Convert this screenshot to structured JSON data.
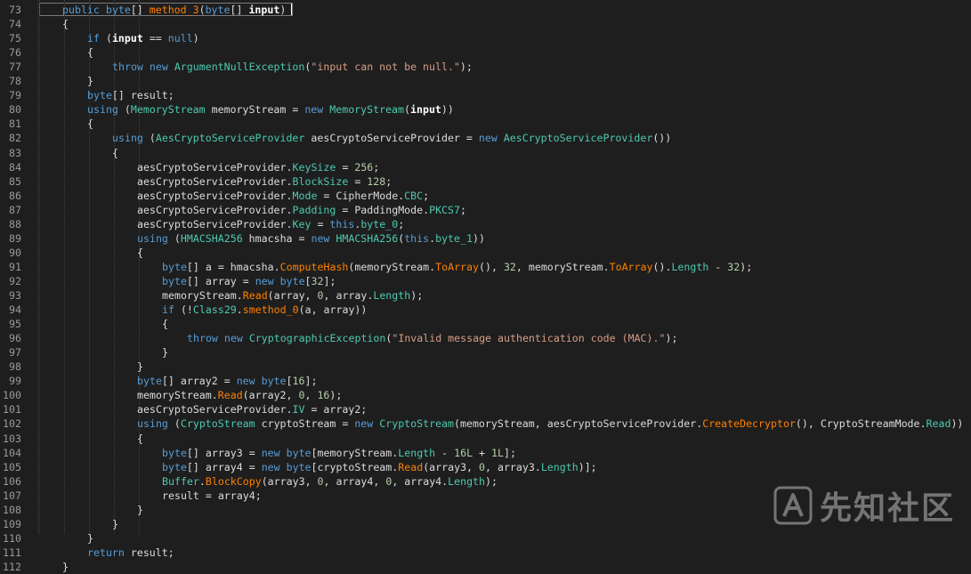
{
  "editor": {
    "lines": [
      {
        "n": "73",
        "indent": 0,
        "tokens": [
          [
            "kw",
            "public "
          ],
          [
            "kw",
            "byte"
          ],
          [
            "plain",
            "[] "
          ],
          [
            "method",
            "method_3"
          ],
          [
            "plain",
            "("
          ],
          [
            "kw",
            "byte"
          ],
          [
            "plain",
            "[] "
          ],
          [
            "bold",
            "input"
          ],
          [
            "plain",
            ")"
          ]
        ]
      },
      {
        "n": "74",
        "indent": 0,
        "tokens": [
          [
            "plain",
            "{"
          ]
        ]
      },
      {
        "n": "75",
        "indent": 1,
        "tokens": [
          [
            "kw",
            "if"
          ],
          [
            "plain",
            " ("
          ],
          [
            "bold",
            "input"
          ],
          [
            "plain",
            " == "
          ],
          [
            "kw",
            "null"
          ],
          [
            "plain",
            ")"
          ]
        ]
      },
      {
        "n": "76",
        "indent": 1,
        "tokens": [
          [
            "plain",
            "{"
          ]
        ]
      },
      {
        "n": "77",
        "indent": 2,
        "tokens": [
          [
            "kw",
            "throw new "
          ],
          [
            "type",
            "ArgumentNullException"
          ],
          [
            "plain",
            "("
          ],
          [
            "str",
            "\"input can not be null.\""
          ],
          [
            "plain",
            ");"
          ]
        ]
      },
      {
        "n": "78",
        "indent": 1,
        "tokens": [
          [
            "plain",
            "}"
          ]
        ]
      },
      {
        "n": "79",
        "indent": 1,
        "tokens": [
          [
            "kw",
            "byte"
          ],
          [
            "plain",
            "[] result;"
          ]
        ]
      },
      {
        "n": "80",
        "indent": 1,
        "tokens": [
          [
            "kw",
            "using"
          ],
          [
            "plain",
            " ("
          ],
          [
            "type",
            "MemoryStream"
          ],
          [
            "plain",
            " memoryStream = "
          ],
          [
            "kw",
            "new "
          ],
          [
            "type",
            "MemoryStream"
          ],
          [
            "plain",
            "("
          ],
          [
            "bold",
            "input"
          ],
          [
            "plain",
            "))"
          ]
        ]
      },
      {
        "n": "81",
        "indent": 1,
        "tokens": [
          [
            "plain",
            "{"
          ]
        ]
      },
      {
        "n": "82",
        "indent": 2,
        "tokens": [
          [
            "kw",
            "using"
          ],
          [
            "plain",
            " ("
          ],
          [
            "type",
            "AesCryptoServiceProvider"
          ],
          [
            "plain",
            " aesCryptoServiceProvider = "
          ],
          [
            "kw",
            "new "
          ],
          [
            "type",
            "AesCryptoServiceProvider"
          ],
          [
            "plain",
            "())"
          ]
        ]
      },
      {
        "n": "83",
        "indent": 2,
        "tokens": [
          [
            "plain",
            "{"
          ]
        ]
      },
      {
        "n": "84",
        "indent": 3,
        "tokens": [
          [
            "plain",
            "aesCryptoServiceProvider."
          ],
          [
            "prop",
            "KeySize"
          ],
          [
            "plain",
            " = "
          ],
          [
            "num",
            "256"
          ],
          [
            "plain",
            ";"
          ]
        ]
      },
      {
        "n": "85",
        "indent": 3,
        "tokens": [
          [
            "plain",
            "aesCryptoServiceProvider."
          ],
          [
            "prop",
            "BlockSize"
          ],
          [
            "plain",
            " = "
          ],
          [
            "num",
            "128"
          ],
          [
            "plain",
            ";"
          ]
        ]
      },
      {
        "n": "86",
        "indent": 3,
        "tokens": [
          [
            "plain",
            "aesCryptoServiceProvider."
          ],
          [
            "prop",
            "Mode"
          ],
          [
            "plain",
            " = CipherMode."
          ],
          [
            "prop",
            "CBC"
          ],
          [
            "plain",
            ";"
          ]
        ]
      },
      {
        "n": "87",
        "indent": 3,
        "tokens": [
          [
            "plain",
            "aesCryptoServiceProvider."
          ],
          [
            "prop",
            "Padding"
          ],
          [
            "plain",
            " = PaddingMode."
          ],
          [
            "prop",
            "PKCS7"
          ],
          [
            "plain",
            ";"
          ]
        ]
      },
      {
        "n": "88",
        "indent": 3,
        "tokens": [
          [
            "plain",
            "aesCryptoServiceProvider."
          ],
          [
            "prop",
            "Key"
          ],
          [
            "plain",
            " = "
          ],
          [
            "kw",
            "this"
          ],
          [
            "plain",
            "."
          ],
          [
            "prop",
            "byte_0"
          ],
          [
            "plain",
            ";"
          ]
        ]
      },
      {
        "n": "89",
        "indent": 3,
        "tokens": [
          [
            "kw",
            "using"
          ],
          [
            "plain",
            " ("
          ],
          [
            "type",
            "HMACSHA256"
          ],
          [
            "plain",
            " hmacsha = "
          ],
          [
            "kw",
            "new "
          ],
          [
            "type",
            "HMACSHA256"
          ],
          [
            "plain",
            "("
          ],
          [
            "kw",
            "this"
          ],
          [
            "plain",
            "."
          ],
          [
            "prop",
            "byte_1"
          ],
          [
            "plain",
            "))"
          ]
        ]
      },
      {
        "n": "90",
        "indent": 3,
        "tokens": [
          [
            "plain",
            "{"
          ]
        ]
      },
      {
        "n": "91",
        "indent": 4,
        "tokens": [
          [
            "kw",
            "byte"
          ],
          [
            "plain",
            "[] a = hmacsha."
          ],
          [
            "method",
            "ComputeHash"
          ],
          [
            "plain",
            "(memoryStream."
          ],
          [
            "method",
            "ToArray"
          ],
          [
            "plain",
            "(), "
          ],
          [
            "num",
            "32"
          ],
          [
            "plain",
            ", memoryStream."
          ],
          [
            "method",
            "ToArray"
          ],
          [
            "plain",
            "()."
          ],
          [
            "prop",
            "Length"
          ],
          [
            "plain",
            " - "
          ],
          [
            "num",
            "32"
          ],
          [
            "plain",
            ");"
          ]
        ]
      },
      {
        "n": "92",
        "indent": 4,
        "tokens": [
          [
            "kw",
            "byte"
          ],
          [
            "plain",
            "[] array = "
          ],
          [
            "kw",
            "new byte"
          ],
          [
            "plain",
            "["
          ],
          [
            "num",
            "32"
          ],
          [
            "plain",
            "];"
          ]
        ]
      },
      {
        "n": "93",
        "indent": 4,
        "tokens": [
          [
            "plain",
            "memoryStream."
          ],
          [
            "method",
            "Read"
          ],
          [
            "plain",
            "(array, "
          ],
          [
            "num",
            "0"
          ],
          [
            "plain",
            ", array."
          ],
          [
            "prop",
            "Length"
          ],
          [
            "plain",
            ");"
          ]
        ]
      },
      {
        "n": "94",
        "indent": 4,
        "tokens": [
          [
            "kw",
            "if"
          ],
          [
            "plain",
            " (!"
          ],
          [
            "type",
            "Class29"
          ],
          [
            "plain",
            "."
          ],
          [
            "method",
            "smethod_0"
          ],
          [
            "plain",
            "(a, array))"
          ]
        ]
      },
      {
        "n": "95",
        "indent": 4,
        "tokens": [
          [
            "plain",
            "{"
          ]
        ]
      },
      {
        "n": "96",
        "indent": 5,
        "tokens": [
          [
            "kw",
            "throw new "
          ],
          [
            "type",
            "CryptographicException"
          ],
          [
            "plain",
            "("
          ],
          [
            "str",
            "\"Invalid message authentication code (MAC).\""
          ],
          [
            "plain",
            ");"
          ]
        ]
      },
      {
        "n": "97",
        "indent": 4,
        "tokens": [
          [
            "plain",
            "}"
          ]
        ]
      },
      {
        "n": "98",
        "indent": 3,
        "tokens": [
          [
            "plain",
            "}"
          ]
        ]
      },
      {
        "n": "99",
        "indent": 3,
        "tokens": [
          [
            "kw",
            "byte"
          ],
          [
            "plain",
            "[] array2 = "
          ],
          [
            "kw",
            "new byte"
          ],
          [
            "plain",
            "["
          ],
          [
            "num",
            "16"
          ],
          [
            "plain",
            "];"
          ]
        ]
      },
      {
        "n": "100",
        "indent": 3,
        "tokens": [
          [
            "plain",
            "memoryStream."
          ],
          [
            "method",
            "Read"
          ],
          [
            "plain",
            "(array2, "
          ],
          [
            "num",
            "0"
          ],
          [
            "plain",
            ", "
          ],
          [
            "num",
            "16"
          ],
          [
            "plain",
            ");"
          ]
        ]
      },
      {
        "n": "101",
        "indent": 3,
        "tokens": [
          [
            "plain",
            "aesCryptoServiceProvider."
          ],
          [
            "prop",
            "IV"
          ],
          [
            "plain",
            " = array2;"
          ]
        ]
      },
      {
        "n": "102",
        "indent": 3,
        "tokens": [
          [
            "kw",
            "using"
          ],
          [
            "plain",
            " ("
          ],
          [
            "type",
            "CryptoStream"
          ],
          [
            "plain",
            " cryptoStream = "
          ],
          [
            "kw",
            "new "
          ],
          [
            "type",
            "CryptoStream"
          ],
          [
            "plain",
            "(memoryStream, aesCryptoServiceProvider."
          ],
          [
            "method",
            "CreateDecryptor"
          ],
          [
            "plain",
            "(), CryptoStreamMode."
          ],
          [
            "prop",
            "Read"
          ],
          [
            "plain",
            "))"
          ]
        ]
      },
      {
        "n": "103",
        "indent": 3,
        "tokens": [
          [
            "plain",
            "{"
          ]
        ]
      },
      {
        "n": "104",
        "indent": 4,
        "tokens": [
          [
            "kw",
            "byte"
          ],
          [
            "plain",
            "[] array3 = "
          ],
          [
            "kw",
            "new byte"
          ],
          [
            "plain",
            "[memoryStream."
          ],
          [
            "prop",
            "Length"
          ],
          [
            "plain",
            " - "
          ],
          [
            "num",
            "16L"
          ],
          [
            "plain",
            " + "
          ],
          [
            "num",
            "1L"
          ],
          [
            "plain",
            "];"
          ]
        ]
      },
      {
        "n": "105",
        "indent": 4,
        "tokens": [
          [
            "kw",
            "byte"
          ],
          [
            "plain",
            "[] array4 = "
          ],
          [
            "kw",
            "new byte"
          ],
          [
            "plain",
            "[cryptoStream."
          ],
          [
            "method",
            "Read"
          ],
          [
            "plain",
            "(array3, "
          ],
          [
            "num",
            "0"
          ],
          [
            "plain",
            ", array3."
          ],
          [
            "prop",
            "Length"
          ],
          [
            "plain",
            ")];"
          ]
        ]
      },
      {
        "n": "106",
        "indent": 4,
        "tokens": [
          [
            "type",
            "Buffer"
          ],
          [
            "plain",
            "."
          ],
          [
            "method",
            "BlockCopy"
          ],
          [
            "plain",
            "(array3, "
          ],
          [
            "num",
            "0"
          ],
          [
            "plain",
            ", array4, "
          ],
          [
            "num",
            "0"
          ],
          [
            "plain",
            ", array4."
          ],
          [
            "prop",
            "Length"
          ],
          [
            "plain",
            ");"
          ]
        ]
      },
      {
        "n": "107",
        "indent": 4,
        "tokens": [
          [
            "plain",
            "result = array4;"
          ]
        ]
      },
      {
        "n": "108",
        "indent": 3,
        "tokens": [
          [
            "plain",
            "}"
          ]
        ]
      },
      {
        "n": "109",
        "indent": 2,
        "tokens": [
          [
            "plain",
            "}"
          ]
        ]
      },
      {
        "n": "110",
        "indent": 1,
        "tokens": [
          [
            "plain",
            "}"
          ]
        ]
      },
      {
        "n": "111",
        "indent": 1,
        "tokens": [
          [
            "kw",
            "return"
          ],
          [
            "plain",
            " result;"
          ]
        ]
      },
      {
        "n": "112",
        "indent": 0,
        "tokens": [
          [
            "plain",
            "}"
          ]
        ]
      }
    ]
  },
  "watermark": {
    "text": "先知社区",
    "logo_icon": "xianzhi-logo-icon"
  },
  "colors": {
    "background": "#1e1e1e",
    "keyword": "#569cd6",
    "type": "#4ec9b0",
    "method": "#ff8000",
    "string": "#d69d85",
    "number": "#b5cea8"
  }
}
